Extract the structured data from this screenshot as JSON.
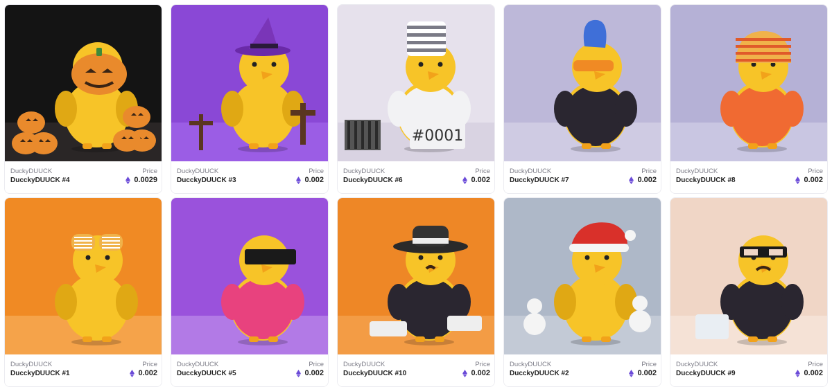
{
  "cards": [
    {
      "collection": "DuckyDUUCK",
      "name": "DucckyDUUCK #4",
      "price_label": "Price",
      "price": "0.0029",
      "bg": "#141414",
      "floor": "#2a2626",
      "accessory": "pumpkin-icon"
    },
    {
      "collection": "DuckyDUUCK",
      "name": "DucckyDUUCK #3",
      "price_label": "Price",
      "price": "0.002",
      "bg": "#8a48d6",
      "floor": "#9b5de5",
      "accessory": "witch-hat-icon"
    },
    {
      "collection": "DuckyDUUCK",
      "name": "DucckyDUUCK #6",
      "price_label": "Price",
      "price": "0.002",
      "bg": "#e6e1ec",
      "floor": "#d9d3e2",
      "accessory": "prisoner-icon",
      "sign": "#0001"
    },
    {
      "collection": "DuckyDUUCK",
      "name": "DucckyDUUCK #7",
      "price_label": "Price",
      "price": "0.002",
      "bg": "#bdb8d9",
      "floor": "#cfcbe3",
      "accessory": "mohawk-icon"
    },
    {
      "collection": "DuckyDUUCK",
      "name": "DucckyDUUCK #8",
      "price_label": "Price",
      "price": "0.002",
      "bg": "#b5b1d6",
      "floor": "#c9c6e2",
      "accessory": "beanie-icon"
    },
    {
      "collection": "DuckyDUUCK",
      "name": "DucckyDUUCK #1",
      "price_label": "Price",
      "price": "0.002",
      "bg": "#f08a24",
      "floor": "#f5a34a",
      "accessory": "shutter-glasses-icon"
    },
    {
      "collection": "DuckyDUUCK",
      "name": "DucckyDUUCK #5",
      "price_label": "Price",
      "price": "0.002",
      "bg": "#9a52dc",
      "floor": "#b27ae6",
      "accessory": "visor-icon"
    },
    {
      "collection": "DuckyDUUCK",
      "name": "DucckyDUUCK #10",
      "price_label": "Price",
      "price": "0.002",
      "bg": "#ee8726",
      "floor": "#f39c45",
      "accessory": "fedora-icon"
    },
    {
      "collection": "DuckyDUUCK",
      "name": "DucckyDUUCK #2",
      "price_label": "Price",
      "price": "0.002",
      "bg": "#aeb8c8",
      "floor": "#c3cad6",
      "accessory": "santa-hat-icon"
    },
    {
      "collection": "DuckyDUUCK",
      "name": "DucckyDUUCK #9",
      "price_label": "Price",
      "price": "0.002",
      "bg": "#f0d6c6",
      "floor": "#f5e2d6",
      "accessory": "glasses-mustache-icon"
    }
  ],
  "colors": {
    "duck": "#f7c428",
    "duck_shade": "#e0a814",
    "beak": "#f2a21a",
    "eth": "#6b4bd8"
  }
}
